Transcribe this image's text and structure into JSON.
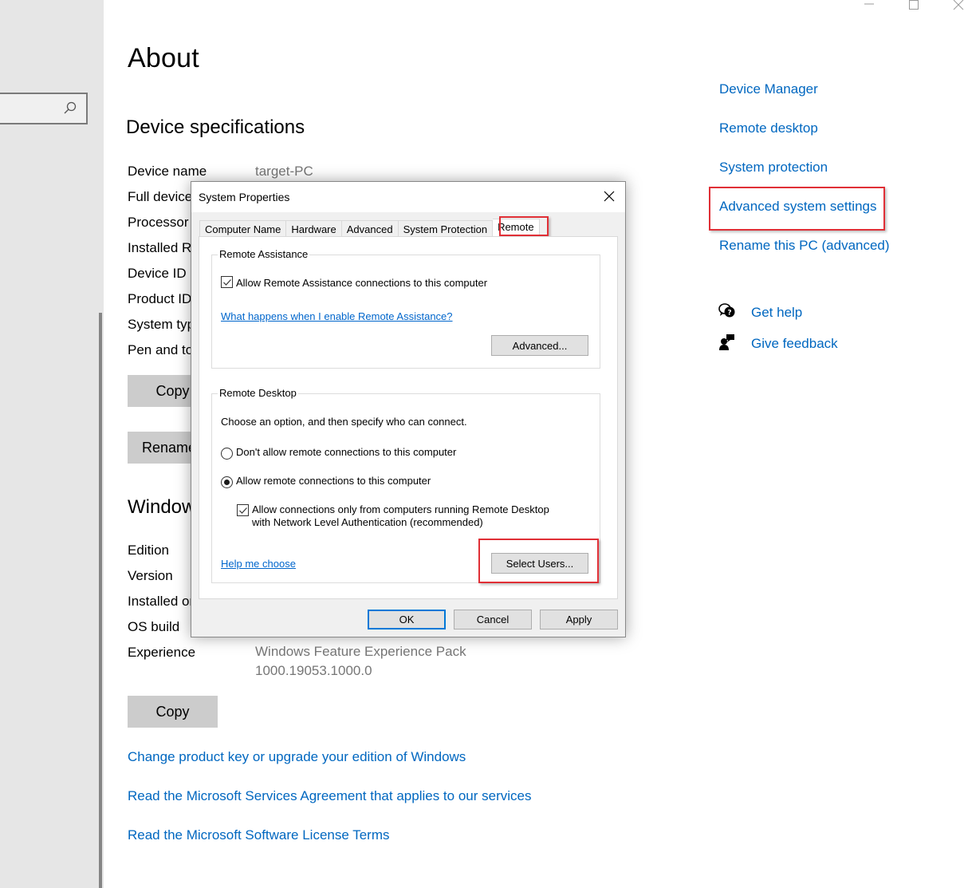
{
  "window": {
    "controls": {
      "minimize": "minimize",
      "maximize": "maximize",
      "close": "close"
    }
  },
  "nav": {
    "search": {
      "placeholder": "",
      "value": ""
    }
  },
  "main": {
    "title": "About",
    "device_specs": {
      "heading": "Device specifications",
      "rows": [
        {
          "label": "Device name",
          "value": "target-PC"
        },
        {
          "label": "Full device name",
          "value": ""
        },
        {
          "label": "Processor",
          "value": ""
        },
        {
          "label": "Installed RAM",
          "value": ""
        },
        {
          "label": "Device ID",
          "value": ""
        },
        {
          "label": "Product ID",
          "value": ""
        },
        {
          "label": "System type",
          "value": ""
        },
        {
          "label": "Pen and touch",
          "value": ""
        }
      ],
      "copy_button": "Copy",
      "rename_button": "Rename this PC"
    },
    "windows_specs": {
      "heading": "Windows specifications",
      "rows": [
        {
          "label": "Edition",
          "value": ""
        },
        {
          "label": "Version",
          "value": ""
        },
        {
          "label": "Installed on",
          "value": ""
        },
        {
          "label": "OS build",
          "value": ""
        },
        {
          "label": "Experience",
          "value": "Windows Feature Experience Pack",
          "value2": "1000.19053.1000.0"
        }
      ],
      "copy_button": "Copy"
    },
    "links": [
      "Change product key or upgrade your edition of Windows",
      "Read the Microsoft Services Agreement that applies to our services",
      "Read the Microsoft Software License Terms"
    ]
  },
  "related": {
    "links": [
      "Device Manager",
      "Remote desktop",
      "System protection",
      "Advanced system settings",
      "Rename this PC (advanced)"
    ],
    "help": [
      {
        "icon": "get-help-icon",
        "label": "Get help"
      },
      {
        "icon": "give-feedback-icon",
        "label": "Give feedback"
      }
    ]
  },
  "dialog": {
    "title": "System Properties",
    "tabs": [
      "Computer Name",
      "Hardware",
      "Advanced",
      "System Protection",
      "Remote"
    ],
    "active_tab": "Remote",
    "remote_assistance": {
      "legend": "Remote Assistance",
      "allow_checkbox": {
        "label": "Allow Remote Assistance connections to this computer",
        "checked": true
      },
      "help_link": "What happens when I enable Remote Assistance?",
      "advanced_button": "Advanced..."
    },
    "remote_desktop": {
      "legend": "Remote Desktop",
      "instruction": "Choose an option, and then specify who can connect.",
      "options": [
        {
          "label": "Don't allow remote connections to this computer",
          "selected": false
        },
        {
          "label": "Allow remote connections to this computer",
          "selected": true
        }
      ],
      "nla_checkbox": {
        "line1": "Allow connections only from computers running Remote Desktop",
        "line2": "with Network Level Authentication (recommended)",
        "checked": true
      },
      "help_link": "Help me choose",
      "select_users_button": "Select Users..."
    },
    "buttons": {
      "ok": "OK",
      "cancel": "Cancel",
      "apply": "Apply"
    }
  },
  "colors": {
    "link_blue": "#0067c0",
    "highlight_red": "#e02f36",
    "default_button_border": "#0078d7"
  }
}
